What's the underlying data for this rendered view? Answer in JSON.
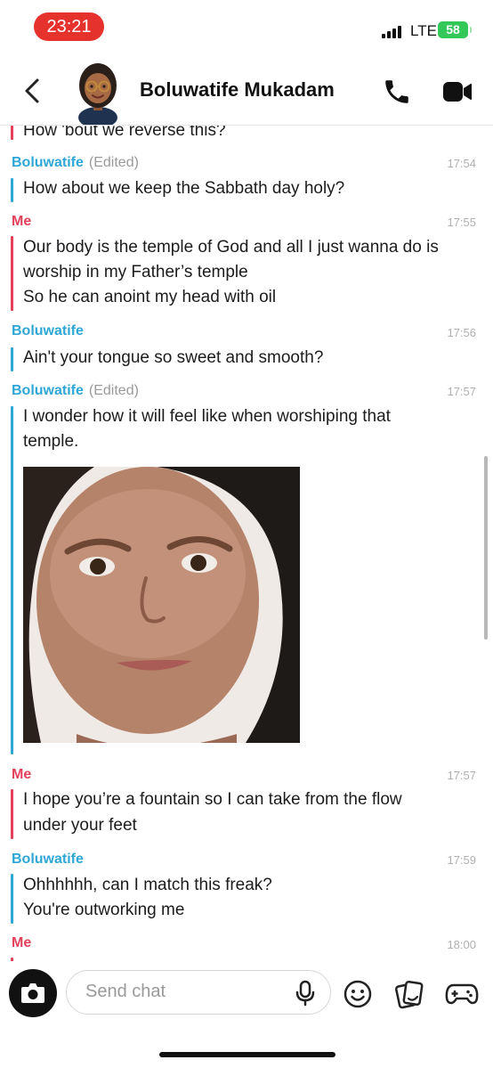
{
  "status": {
    "time": "23:21",
    "network": "LTE",
    "battery": "58",
    "colors": {
      "time_pill": "#e5322d",
      "battery": "#34c759"
    }
  },
  "header": {
    "contact_name": "Boluwatife Mukadam",
    "icons": [
      "chevron-left-icon",
      "bitmoji-avatar",
      "phone-icon",
      "video-camera-icon"
    ]
  },
  "colors": {
    "them": "#2fa7d6",
    "me": "#e3405a"
  },
  "messages": [
    {
      "sender": "",
      "lines": [
        "How 'bout we reverse this?"
      ]
    },
    {
      "sender": "Boluwatife",
      "edited": "(Edited)",
      "time": "17:54",
      "lines": [
        "How about we keep the Sabbath day holy?"
      ]
    },
    {
      "sender": "Me",
      "time": "17:55",
      "lines": [
        "Our body is the temple of God and all I just wanna do is",
        "worship in my Father’s temple",
        "So he can anoint my head with oil"
      ]
    },
    {
      "sender": "Boluwatife",
      "time": "17:56",
      "lines": [
        "Ain't your tongue so sweet and smooth?"
      ]
    },
    {
      "sender": "Boluwatife",
      "edited": "(Edited)",
      "time": "17:57",
      "lines": [
        "I wonder how it will feel like when worshiping that",
        "temple."
      ],
      "attachment": "photo"
    },
    {
      "sender": "Me",
      "time": "17:57",
      "lines": [
        "I hope you’re a fountain so I can take from the flow",
        "under your feet"
      ]
    },
    {
      "sender": "Boluwatife",
      "time": "17:59",
      "lines": [
        "Ohhhhhh, can I match this freak?",
        "You're outworking me"
      ]
    },
    {
      "sender": "Me",
      "time": "18:00",
      "lines": []
    }
  ],
  "input": {
    "placeholder": "Send chat",
    "icons": [
      "camera-icon",
      "microphone-icon",
      "emoji-icon",
      "sticker-icon",
      "game-controller-icon"
    ]
  }
}
